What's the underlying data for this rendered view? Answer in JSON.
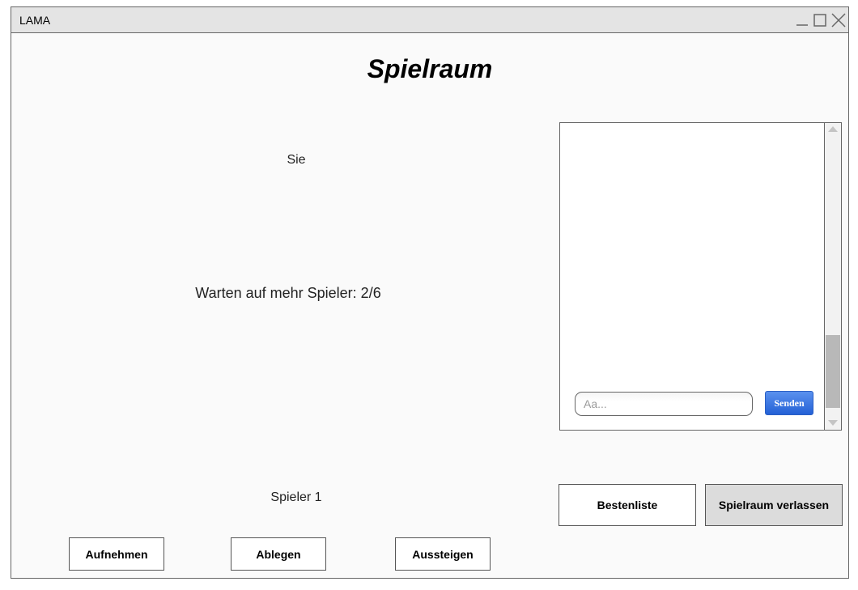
{
  "window": {
    "title": "LAMA",
    "controls": [
      "minimize-icon",
      "maximize-icon",
      "close-icon"
    ]
  },
  "page": {
    "heading": "Spielraum",
    "opponent_label": "Sie",
    "status_text": "Warten auf mehr Spieler: 2/6",
    "player_label": "Spieler 1"
  },
  "actions": {
    "aufnehmen": "Aufnehmen",
    "ablegen": "Ablegen",
    "aussteigen": "Aussteigen",
    "bestenliste": "Bestenliste",
    "verlassen": "Spielraum verlassen"
  },
  "chat": {
    "placeholder": "Aa...",
    "input_value": "",
    "send_label": "Senden",
    "send_color": "#2461d6",
    "messages": []
  }
}
